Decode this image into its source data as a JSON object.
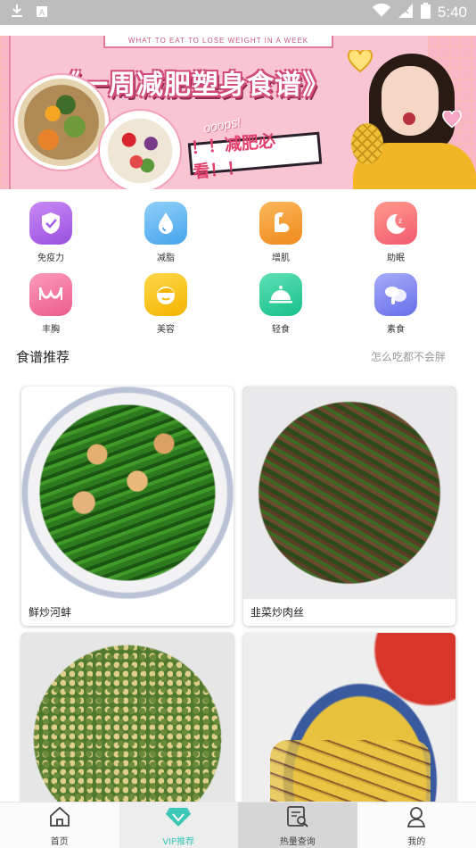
{
  "status_bar": {
    "time": "5:40"
  },
  "banner": {
    "top_caption": "WHAT TO EAT TO LOSE WEIGHT IN A WEEK",
    "title": "《一周减肥塑身食谱》",
    "sticker": "！！减肥必看！！",
    "ooops": "ooops!"
  },
  "categories": [
    {
      "label": "免疫力",
      "icon": "shield-icon",
      "color": "#b266e6"
    },
    {
      "label": "减脂",
      "icon": "water-drop-icon",
      "color": "#57b6f0"
    },
    {
      "label": "增肌",
      "icon": "muscle-arm-icon",
      "color": "#f39a32"
    },
    {
      "label": "助眠",
      "icon": "moon-sleep-icon",
      "color": "#f7707a"
    },
    {
      "label": "丰胸",
      "icon": "bra-icon",
      "color": "#f06f9a"
    },
    {
      "label": "美容",
      "icon": "face-icon",
      "color": "#f4c31d"
    },
    {
      "label": "轻食",
      "icon": "cloche-icon",
      "color": "#2fcf9c"
    },
    {
      "label": "素食",
      "icon": "vegetable-icon",
      "color": "#7f86ef"
    }
  ],
  "section": {
    "title": "食谱推荐",
    "more": "怎么吃都不会胖"
  },
  "recipes": [
    {
      "name": "鲜炒河蚌"
    },
    {
      "name": "韭菜炒肉丝"
    },
    {
      "name": ""
    },
    {
      "name": ""
    }
  ],
  "bottom_nav": [
    {
      "label": "首页",
      "icon": "home-icon"
    },
    {
      "label": "VIP推荐",
      "icon": "vip-diamond-icon"
    },
    {
      "label": "热量查询",
      "icon": "calorie-search-icon"
    },
    {
      "label": "我的",
      "icon": "profile-icon"
    }
  ]
}
